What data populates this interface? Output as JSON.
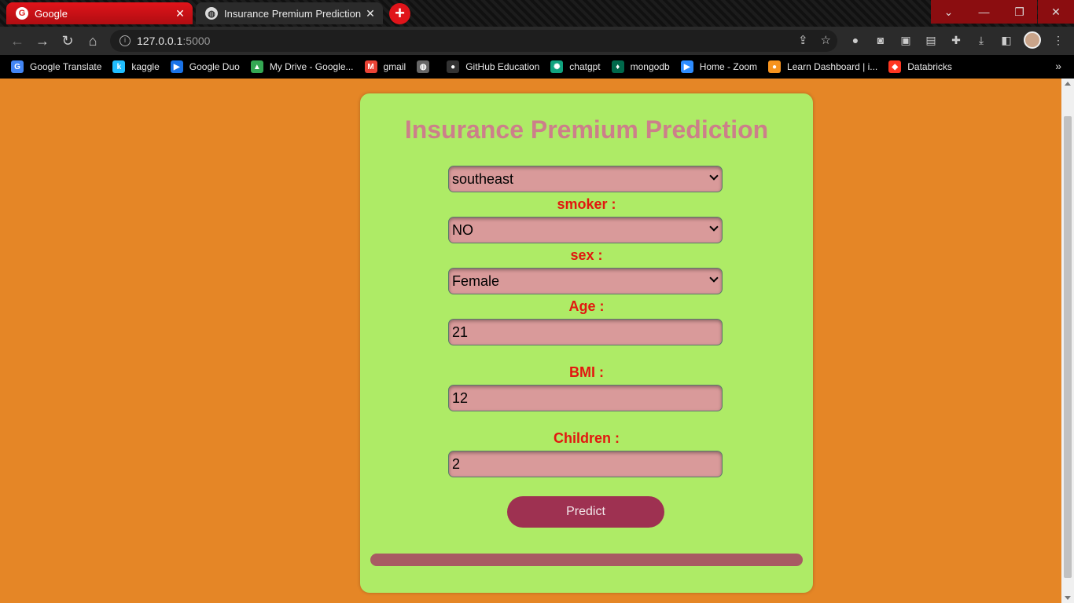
{
  "browser": {
    "tabs": [
      {
        "title": "Google",
        "favicon": "G"
      },
      {
        "title": "Insurance Premium Prediction",
        "favicon": "◍"
      }
    ],
    "new_tab_icon": "+",
    "window_controls": [
      "⌄",
      "—",
      "❐",
      "✕"
    ],
    "url": {
      "host": "127.0.0.1",
      "port": ":5000"
    },
    "bookmarks": [
      {
        "label": "Google Translate",
        "icon": "G",
        "color": "#4285f4"
      },
      {
        "label": "kaggle",
        "icon": "k",
        "color": "#20beff"
      },
      {
        "label": "Google Duo",
        "icon": "▶",
        "color": "#1a73e8"
      },
      {
        "label": "My Drive - Google...",
        "icon": "▲",
        "color": "#34a853"
      },
      {
        "label": "gmail",
        "icon": "M",
        "color": "#ea4335"
      },
      {
        "label": "",
        "icon": "◍",
        "color": "#666666"
      },
      {
        "label": "GitHub Education",
        "icon": "●",
        "color": "#333333"
      },
      {
        "label": "chatgpt",
        "icon": "✺",
        "color": "#10a37f"
      },
      {
        "label": "mongodb",
        "icon": "♦",
        "color": "#00684a"
      },
      {
        "label": "Home - Zoom",
        "icon": "▶",
        "color": "#2d8cff"
      },
      {
        "label": "Learn Dashboard | i...",
        "icon": "●",
        "color": "#f7931e"
      },
      {
        "label": "Databricks",
        "icon": "◆",
        "color": "#ff3621"
      }
    ]
  },
  "form": {
    "title": "Insurance Premium Prediction",
    "region_value": "southeast",
    "smoker_label": "smoker :",
    "smoker_value": "NO",
    "sex_label": "sex :",
    "sex_value": "Female",
    "age_label": "Age :",
    "age_value": "21",
    "bmi_label": "BMI :",
    "bmi_value": "12",
    "children_label": "Children :",
    "children_value": "2",
    "predict_label": "Predict"
  },
  "colors": {
    "page_bg": "#e58626",
    "card_bg": "#aeeb66",
    "title": "#cc7f8a",
    "label": "#e2170f",
    "field_bg": "#d99a9a",
    "button_bg": "#9e3151",
    "result_bar": "#a85a63"
  }
}
